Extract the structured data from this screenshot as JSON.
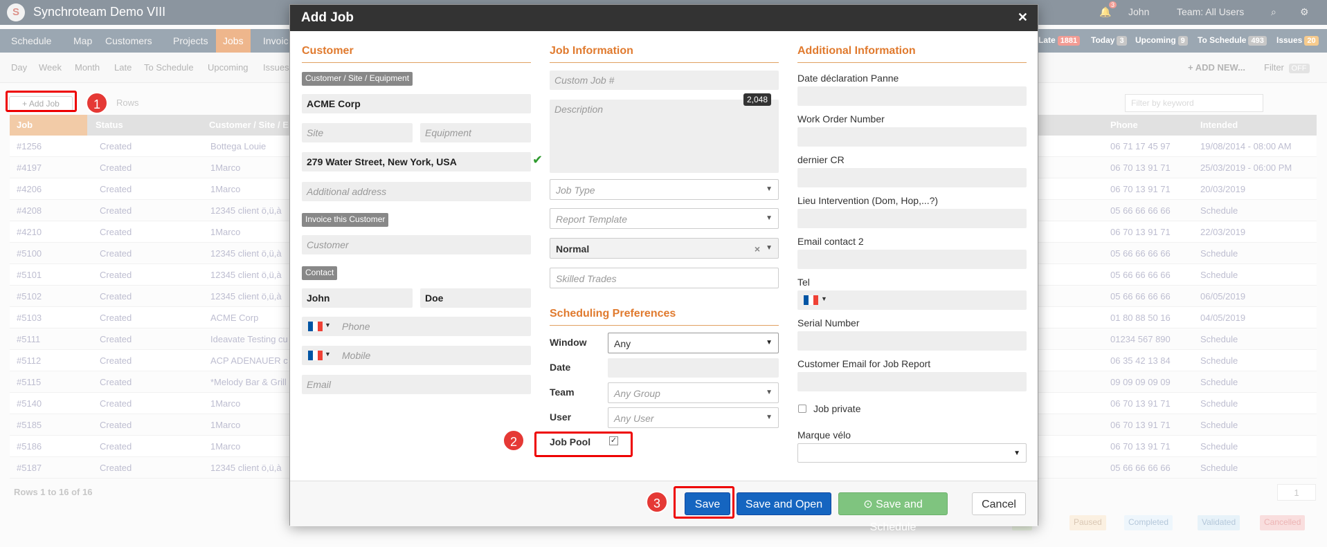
{
  "app": {
    "title": "Synchroteam Demo VIII",
    "notif_count": "3",
    "user": "John",
    "team": "Team: All Users"
  },
  "nav": {
    "items": [
      "Schedule",
      "Map",
      "Customers",
      "Projects",
      "Jobs",
      "Invoic"
    ],
    "counters": [
      {
        "label": "Late",
        "value": "1881",
        "color": "#e74c3c"
      },
      {
        "label": "Today",
        "value": "3",
        "color": "#999"
      },
      {
        "label": "Upcoming",
        "value": "9",
        "color": "#999"
      },
      {
        "label": "To Schedule",
        "value": "493",
        "color": "#999"
      },
      {
        "label": "Issues",
        "value": "20",
        "color": "#f0a030"
      }
    ]
  },
  "subnav": {
    "items": [
      "Day",
      "Week",
      "Month",
      "Late",
      "To Schedule",
      "Upcoming",
      "Issues"
    ],
    "add_new": "+ ADD NEW...",
    "filter": "Filter",
    "filter_state": "OFF"
  },
  "toolbar": {
    "add_job": "+ Add Job",
    "rows": "Rows",
    "filter_placeholder": "Filter by keyword"
  },
  "table": {
    "headers": {
      "job": "Job",
      "status": "Status",
      "customer": "Customer / Site / E",
      "phone": "Phone",
      "intended": "Intended"
    },
    "rows": [
      {
        "job": "#1256",
        "status": "Created",
        "customer": "Bottega Louie",
        "phone": "06 71 17 45 97",
        "intended": "19/08/2014 - 08:00 AM"
      },
      {
        "job": "#4197",
        "status": "Created",
        "customer": "1Marco",
        "phone": "06 70 13 91 71",
        "intended": "25/03/2019 - 06:00 PM"
      },
      {
        "job": "#4206",
        "status": "Created",
        "customer": "1Marco",
        "phone": "06 70 13 91 71",
        "intended": "20/03/2019"
      },
      {
        "job": "#4208",
        "status": "Created",
        "customer": "12345 client ö,ü,à",
        "phone": "05 66 66 66 66",
        "intended": "Schedule"
      },
      {
        "job": "#4210",
        "status": "Created",
        "customer": "1Marco",
        "phone": "06 70 13 91 71",
        "intended": "22/03/2019"
      },
      {
        "job": "#5100",
        "status": "Created",
        "customer": "12345 client ö,ü,à",
        "phone": "05 66 66 66 66",
        "intended": "Schedule"
      },
      {
        "job": "#5101",
        "status": "Created",
        "customer": "12345 client ö,ü,à",
        "phone": "05 66 66 66 66",
        "intended": "Schedule"
      },
      {
        "job": "#5102",
        "status": "Created",
        "customer": "12345 client ö,ü,à",
        "phone": "05 66 66 66 66",
        "intended": "06/05/2019"
      },
      {
        "job": "#5103",
        "status": "Created",
        "customer": "ACME Corp",
        "phone": "01 80 88 50 16",
        "intended": "04/05/2019"
      },
      {
        "job": "#5111",
        "status": "Created",
        "customer": "Ideavate Testing cu",
        "phone": "01234 567 890",
        "intended": "Schedule"
      },
      {
        "job": "#5112",
        "status": "Created",
        "customer": "ACP ADENAUER c",
        "phone": "06 35 42 13 84",
        "intended": "Schedule"
      },
      {
        "job": "#5115",
        "status": "Created",
        "customer": "*Melody Bar & Grill",
        "phone": "09 09 09 09 09",
        "intended": "Schedule"
      },
      {
        "job": "#5140",
        "status": "Created",
        "customer": "1Marco",
        "phone": "06 70 13 91 71",
        "intended": "Schedule"
      },
      {
        "job": "#5185",
        "status": "Created",
        "customer": "1Marco",
        "phone": "06 70 13 91 71",
        "intended": "Schedule"
      },
      {
        "job": "#5186",
        "status": "Created",
        "customer": "1Marco",
        "phone": "06 70 13 91 71",
        "intended": "Schedule"
      },
      {
        "job": "#5187",
        "status": "Created",
        "customer": "12345 client ö,ü,à",
        "phone": "05 66 66 66 66",
        "intended": "Schedule"
      }
    ],
    "footer": "Rows 1 to 16 of 16",
    "page": "1"
  },
  "legend": [
    "ted",
    "Paused",
    "Completed",
    "Validated",
    "Cancelled"
  ],
  "modal": {
    "title": "Add Job",
    "customer": {
      "heading": "Customer",
      "tag": "Customer / Site / Equipment",
      "name": "ACME Corp",
      "site_ph": "Site",
      "equipment_ph": "Equipment",
      "address": "279 Water Street, New York, USA",
      "additional_address_ph": "Additional address",
      "invoice_tag": "Invoice this Customer",
      "invoice_ph": "Customer",
      "contact_tag": "Contact",
      "first_name": "John",
      "last_name": "Doe",
      "phone_ph": "Phone",
      "mobile_ph": "Mobile",
      "email_ph": "Email"
    },
    "job_info": {
      "heading": "Job Information",
      "custom_job_ph": "Custom Job #",
      "description_ph": "Description",
      "char_count": "2,048",
      "job_type_ph": "Job Type",
      "report_template_ph": "Report Template",
      "priority": "Normal",
      "skilled_trades_ph": "Skilled Trades"
    },
    "scheduling": {
      "heading": "Scheduling Preferences",
      "window_label": "Window",
      "window_value": "Any",
      "date_label": "Date",
      "team_label": "Team",
      "team_ph": "Any Group",
      "user_label": "User",
      "user_ph": "Any User",
      "job_pool_label": "Job Pool"
    },
    "additional": {
      "heading": "Additional Information",
      "fields": [
        "Date déclaration Panne",
        "Work Order Number",
        "dernier CR",
        "Lieu Intervention (Dom, Hop,...?)",
        "Email contact 2"
      ],
      "tel_label": "Tel",
      "serial_label": "Serial Number",
      "customer_email_label": "Customer Email for Job Report",
      "job_private_label": "Job private",
      "marque_label": "Marque vélo"
    },
    "buttons": {
      "save": "Save",
      "save_open": "Save and Open",
      "save_schedule": "Save and Schedule",
      "cancel": "Cancel"
    }
  },
  "steps": [
    "1",
    "2",
    "3"
  ]
}
